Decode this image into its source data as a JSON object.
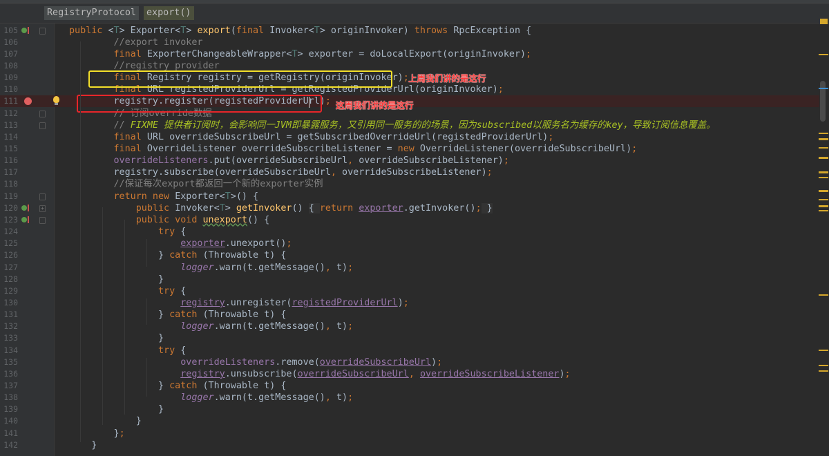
{
  "breadcrumb": {
    "items": [
      "RegistryProtocol",
      "export()"
    ]
  },
  "annotations": {
    "last_week": "上周我们讲的是这行",
    "this_week": "这周我们讲的是这行",
    "colors": {
      "yellow_box": "#f4e02a",
      "red_box": "#e8262a"
    }
  },
  "editor": {
    "breakpoint_line": "111",
    "lines": [
      {
        "n": "105",
        "t": [
          [
            "k",
            "public "
          ],
          [
            "p",
            "<"
          ],
          [
            "tp",
            "T"
          ],
          [
            "p",
            "> Exporter<"
          ],
          [
            "tp",
            "T"
          ],
          [
            "p",
            "> "
          ],
          [
            "f",
            "export"
          ],
          [
            "p",
            "("
          ],
          [
            "k",
            "final "
          ],
          [
            "p",
            "Invoker<"
          ],
          [
            "tp",
            "T"
          ],
          [
            "p",
            "> originInvoker) "
          ],
          [
            "k",
            "throws "
          ],
          [
            "p",
            "RpcException {"
          ]
        ]
      },
      {
        "n": "106",
        "t": [
          [
            "c",
            "        //export invoker"
          ]
        ]
      },
      {
        "n": "107",
        "t": [
          [
            "k",
            "        final "
          ],
          [
            "p",
            "ExporterChangeableWrapper<"
          ],
          [
            "tp",
            "T"
          ],
          [
            "p",
            "> exporter = doLocalExport(originInvoker)"
          ],
          [
            "k",
            ";"
          ]
        ]
      },
      {
        "n": "108",
        "t": [
          [
            "c",
            "        //registry provider"
          ]
        ]
      },
      {
        "n": "109",
        "t": [
          [
            "k",
            "        final "
          ],
          [
            "p",
            "Registry registry = getRegistry(originInvoker)"
          ],
          [
            "k",
            ";"
          ]
        ]
      },
      {
        "n": "110",
        "t": [
          [
            "k",
            "        final "
          ],
          [
            "p",
            "URL registedProviderUrl = getRegistedProviderUrl(originInvoker)"
          ],
          [
            "k",
            ";"
          ]
        ]
      },
      {
        "n": "111",
        "t": [
          [
            "p",
            "        registry.register(registedProviderUrl)"
          ],
          [
            "k",
            ";"
          ]
        ]
      },
      {
        "n": "112",
        "t": [
          [
            "c",
            "        // 订阅override数据"
          ]
        ]
      },
      {
        "n": "113",
        "t": [
          [
            "c",
            "        // "
          ],
          [
            "fx",
            "FIXME 提供者订阅时，会影响同一JVM即暴露服务，又引用同一服务的的场景，因为subscribed以服务名为缓存的key，导致订阅信息覆盖。"
          ]
        ]
      },
      {
        "n": "114",
        "t": [
          [
            "k",
            "        final "
          ],
          [
            "p",
            "URL overrideSubscribeUrl = getSubscribedOverrideUrl(registedProviderUrl)"
          ],
          [
            "k",
            ";"
          ]
        ]
      },
      {
        "n": "115",
        "t": [
          [
            "k",
            "        final "
          ],
          [
            "p",
            "OverrideListener overrideSubscribeListener = "
          ],
          [
            "k",
            "new "
          ],
          [
            "p",
            "OverrideListener(overrideSubscribeUrl)"
          ],
          [
            "k",
            ";"
          ]
        ]
      },
      {
        "n": "116",
        "t": [
          [
            "v",
            "        overrideListeners"
          ],
          [
            "p",
            ".put(overrideSubscribeUrl"
          ],
          [
            "k",
            ", "
          ],
          [
            "p",
            "overrideSubscribeListener)"
          ],
          [
            "k",
            ";"
          ]
        ]
      },
      {
        "n": "117",
        "t": [
          [
            "p",
            "        registry.subscribe(overrideSubscribeUrl"
          ],
          [
            "k",
            ", "
          ],
          [
            "p",
            "overrideSubscribeListener)"
          ],
          [
            "k",
            ";"
          ]
        ]
      },
      {
        "n": "118",
        "t": [
          [
            "c",
            "        //保证每次export都返回一个新的exporter实例"
          ]
        ]
      },
      {
        "n": "119",
        "t": [
          [
            "k",
            "        return new "
          ],
          [
            "p",
            "Exporter<"
          ],
          [
            "tp",
            "T"
          ],
          [
            "p",
            ">() {"
          ]
        ]
      },
      {
        "n": "120",
        "t": [
          [
            "k",
            "            public "
          ],
          [
            "p",
            "Invoker<"
          ],
          [
            "tp",
            "T"
          ],
          [
            "p",
            "> "
          ],
          [
            "f",
            "getInvoker"
          ],
          [
            "p",
            "() "
          ],
          [
            "fold",
            "{ "
          ],
          [
            "k",
            "return "
          ],
          [
            "vu",
            "exporter"
          ],
          [
            "p",
            ".getInvoker()"
          ],
          [
            "k",
            ";"
          ],
          [
            "fold",
            " }"
          ]
        ]
      },
      {
        "n": "123",
        "t": [
          [
            "k",
            "            public void "
          ],
          [
            "fu",
            "unexport"
          ],
          [
            "p",
            "() {"
          ]
        ]
      },
      {
        "n": "124",
        "t": [
          [
            "k",
            "                try "
          ],
          [
            "p",
            "{"
          ]
        ]
      },
      {
        "n": "125",
        "t": [
          [
            "p",
            "                    "
          ],
          [
            "vu",
            "exporter"
          ],
          [
            "p",
            ".unexport()"
          ],
          [
            "k",
            ";"
          ]
        ]
      },
      {
        "n": "126",
        "t": [
          [
            "p",
            "                } "
          ],
          [
            "k",
            "catch "
          ],
          [
            "p",
            "(Throwable t) {"
          ]
        ]
      },
      {
        "n": "127",
        "t": [
          [
            "p",
            "                    "
          ],
          [
            "lg",
            "logger"
          ],
          [
            "p",
            ".warn(t.getMessage()"
          ],
          [
            "k",
            ", "
          ],
          [
            "p",
            "t)"
          ],
          [
            "k",
            ";"
          ]
        ]
      },
      {
        "n": "128",
        "t": [
          [
            "p",
            "                }"
          ]
        ]
      },
      {
        "n": "129",
        "t": [
          [
            "k",
            "                try "
          ],
          [
            "p",
            "{"
          ]
        ]
      },
      {
        "n": "130",
        "t": [
          [
            "p",
            "                    "
          ],
          [
            "vu",
            "registry"
          ],
          [
            "p",
            ".unregister("
          ],
          [
            "vu",
            "registedProviderUrl"
          ],
          [
            "p",
            ")"
          ],
          [
            "k",
            ";"
          ]
        ]
      },
      {
        "n": "131",
        "t": [
          [
            "p",
            "                } "
          ],
          [
            "k",
            "catch "
          ],
          [
            "p",
            "(Throwable t) {"
          ]
        ]
      },
      {
        "n": "132",
        "t": [
          [
            "p",
            "                    "
          ],
          [
            "lg",
            "logger"
          ],
          [
            "p",
            ".warn(t.getMessage()"
          ],
          [
            "k",
            ", "
          ],
          [
            "p",
            "t)"
          ],
          [
            "k",
            ";"
          ]
        ]
      },
      {
        "n": "133",
        "t": [
          [
            "p",
            "                }"
          ]
        ]
      },
      {
        "n": "134",
        "t": [
          [
            "k",
            "                try "
          ],
          [
            "p",
            "{"
          ]
        ]
      },
      {
        "n": "135",
        "t": [
          [
            "v",
            "                    overrideListeners"
          ],
          [
            "p",
            ".remove("
          ],
          [
            "vu",
            "overrideSubscribeUrl"
          ],
          [
            "p",
            ")"
          ],
          [
            "k",
            ";"
          ]
        ]
      },
      {
        "n": "136",
        "t": [
          [
            "p",
            "                    "
          ],
          [
            "vu",
            "registry"
          ],
          [
            "p",
            ".unsubscribe("
          ],
          [
            "vu",
            "overrideSubscribeUrl"
          ],
          [
            "k",
            ", "
          ],
          [
            "vu",
            "overrideSubscribeListener"
          ],
          [
            "p",
            ")"
          ],
          [
            "k",
            ";"
          ]
        ]
      },
      {
        "n": "137",
        "t": [
          [
            "p",
            "                } "
          ],
          [
            "k",
            "catch "
          ],
          [
            "p",
            "(Throwable t) {"
          ]
        ]
      },
      {
        "n": "138",
        "t": [
          [
            "p",
            "                    "
          ],
          [
            "lg",
            "logger"
          ],
          [
            "p",
            ".warn(t.getMessage()"
          ],
          [
            "k",
            ", "
          ],
          [
            "p",
            "t)"
          ],
          [
            "k",
            ";"
          ]
        ]
      },
      {
        "n": "139",
        "t": [
          [
            "p",
            "                }"
          ]
        ]
      },
      {
        "n": "140",
        "t": [
          [
            "p",
            "            }"
          ]
        ]
      },
      {
        "n": "141",
        "t": [
          [
            "p",
            "        }"
          ],
          [
            "k",
            ";"
          ]
        ]
      },
      {
        "n": "142",
        "t": [
          [
            "p",
            "    }"
          ]
        ]
      }
    ]
  }
}
